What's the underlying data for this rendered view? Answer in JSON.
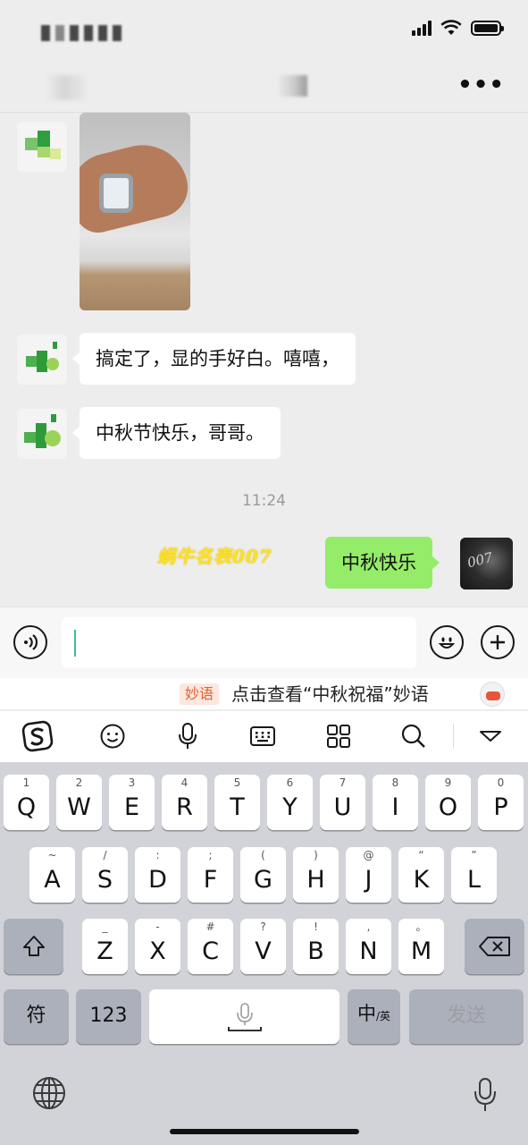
{
  "status_bar": {
    "icons": [
      "signal-icon",
      "wifi-icon",
      "battery-icon"
    ]
  },
  "nav": {
    "more_label": "•••"
  },
  "chat": {
    "messages": [
      {
        "sender": "contact",
        "type": "image"
      },
      {
        "sender": "contact",
        "type": "text",
        "text": "搞定了，显的手好白。嘻嘻，"
      },
      {
        "sender": "contact",
        "type": "text",
        "text": "中秋节快乐，哥哥。"
      },
      {
        "type": "timestamp",
        "text": "11:24"
      },
      {
        "sender": "me",
        "type": "text",
        "text": "中秋快乐"
      }
    ],
    "my_signature": "蜗牛名表007",
    "my_avatar_text": "007"
  },
  "input": {
    "value": "",
    "placeholder": ""
  },
  "suggestion": {
    "tag": "妙语",
    "text": "点击查看“中秋祝福”妙语"
  },
  "keyboard": {
    "toolbar": [
      "sogou-logo-icon",
      "emoji-icon",
      "microphone-icon",
      "keyboard-icon",
      "grid-icon",
      "search-icon",
      "collapse-icon"
    ],
    "rows": [
      [
        {
          "k": "Q",
          "s": "1"
        },
        {
          "k": "W",
          "s": "2"
        },
        {
          "k": "E",
          "s": "3"
        },
        {
          "k": "R",
          "s": "4"
        },
        {
          "k": "T",
          "s": "5"
        },
        {
          "k": "Y",
          "s": "6"
        },
        {
          "k": "U",
          "s": "7"
        },
        {
          "k": "I",
          "s": "8"
        },
        {
          "k": "O",
          "s": "9"
        },
        {
          "k": "P",
          "s": "0"
        }
      ],
      [
        {
          "k": "A",
          "s": "~"
        },
        {
          "k": "S",
          "s": "/"
        },
        {
          "k": "D",
          "s": ":"
        },
        {
          "k": "F",
          "s": ";"
        },
        {
          "k": "G",
          "s": "("
        },
        {
          "k": "H",
          "s": ")"
        },
        {
          "k": "J",
          "s": "@"
        },
        {
          "k": "K",
          "s": "“"
        },
        {
          "k": "L",
          "s": "”"
        }
      ],
      [
        {
          "k": "Z",
          "s": "_"
        },
        {
          "k": "X",
          "s": "-"
        },
        {
          "k": "C",
          "s": "#"
        },
        {
          "k": "V",
          "s": "?"
        },
        {
          "k": "B",
          "s": "!"
        },
        {
          "k": "N",
          "s": ","
        },
        {
          "k": "M",
          "s": "。"
        }
      ]
    ],
    "symbol_key": "符",
    "number_key": "123",
    "lang_key": "中",
    "lang_key_sub": "/英",
    "send_key": "发送"
  }
}
